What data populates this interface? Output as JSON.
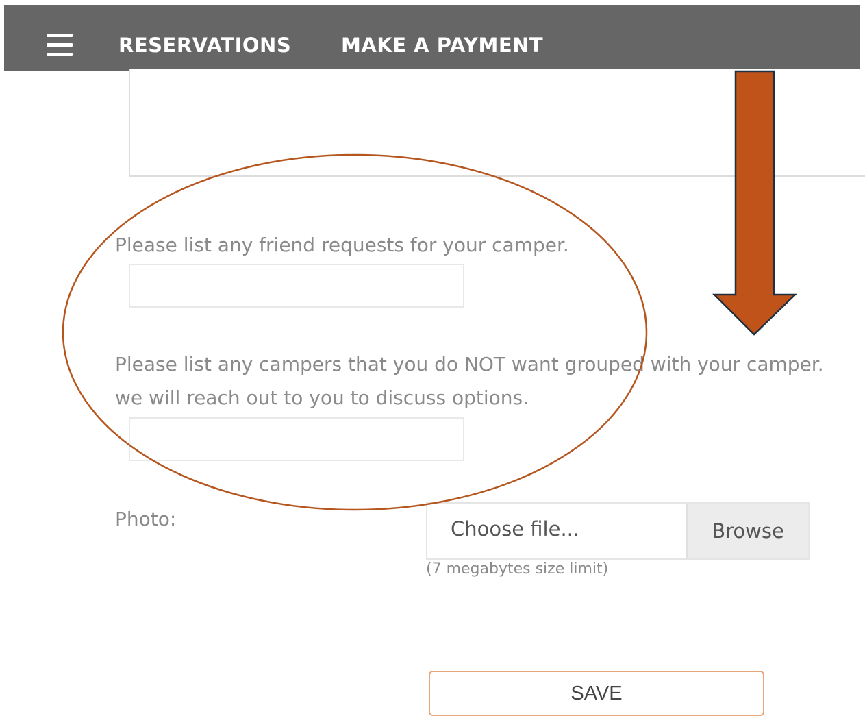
{
  "navbar": {
    "menu_icon": "hamburger-menu-icon",
    "links": [
      {
        "label": "RESERVATIONS"
      },
      {
        "label": "MAKE A PAYMENT"
      }
    ]
  },
  "form": {
    "friend_requests": {
      "label": "Please list any friend requests for your camper.",
      "value": ""
    },
    "not_grouped": {
      "label_line1": "Please list any campers that you do NOT want grouped with your camper.",
      "label_line2": "we will reach out to you to discuss options.",
      "value": ""
    },
    "photo": {
      "label": "Photo:",
      "file_placeholder": "Choose file...",
      "browse_label": "Browse",
      "size_hint": "(7 megabytes size limit)"
    },
    "save_label": "SAVE"
  },
  "annotations": {
    "color": "#c0531a",
    "ellipse_icon": "highlight-ellipse",
    "arrow_icon": "down-arrow-icon"
  }
}
